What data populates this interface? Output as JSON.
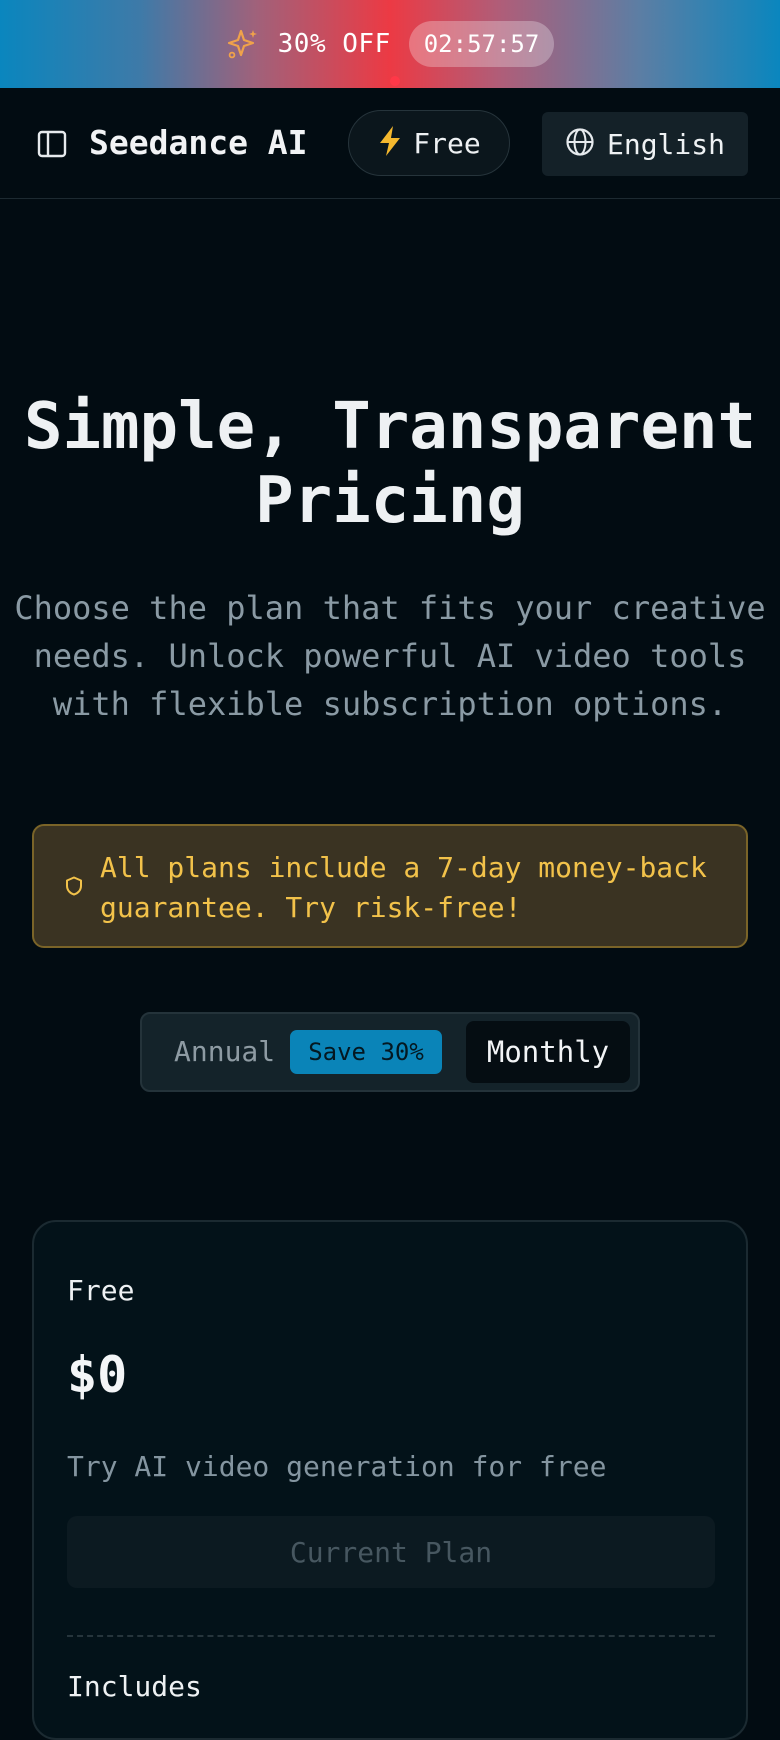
{
  "promo": {
    "text": "30% OFF",
    "timer": "02:57:57",
    "icon": "sparkle-icon"
  },
  "navbar": {
    "brand": "Seedance AI",
    "plan_badge": "Free",
    "language": "English",
    "sidebar_icon": "sidebar-toggle-icon",
    "bolt_icon": "lightning-bolt-icon",
    "globe_icon": "globe-icon"
  },
  "hero": {
    "title": "Simple, Transparent Pricing",
    "subtitle": "Choose the plan that fits your creative needs. Unlock powerful AI video tools with flexible subscription options."
  },
  "guarantee": {
    "text": "All plans include a 7-day money-back guarantee. Try risk-free!",
    "icon": "shield-icon"
  },
  "billing": {
    "annual_label": "Annual",
    "save_badge": "Save 30%",
    "monthly_label": "Monthly",
    "selected": "Monthly"
  },
  "plan": {
    "name": "Free",
    "price": "$0",
    "description": "Try AI video generation for free",
    "button_label": "Current Plan",
    "includes_label": "Includes"
  },
  "colors": {
    "accent_blue": "#0a84b8",
    "promo_red": "#ec3a44",
    "guarantee_text": "#f2c24a",
    "bolt": "#f5b82e",
    "background": "#020c12"
  }
}
